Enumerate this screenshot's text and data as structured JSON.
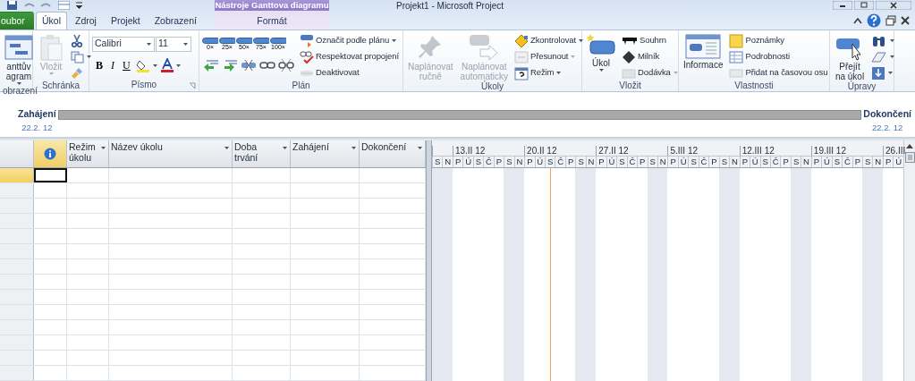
{
  "window": {
    "title": "Projekt1  -  Microsoft Project",
    "contextual_header": "Nástroje Ganttova diagramu"
  },
  "tabs": [
    {
      "label": "oubor",
      "kind": "file",
      "selected": false
    },
    {
      "label": "Úkol",
      "kind": "tab",
      "selected": true
    },
    {
      "label": "Zdroj",
      "kind": "tab",
      "selected": false
    },
    {
      "label": "Projekt",
      "kind": "tab",
      "selected": false
    },
    {
      "label": "Zobrazení",
      "kind": "tab",
      "selected": false
    },
    {
      "label": "Formát",
      "kind": "contextual",
      "selected": false
    }
  ],
  "ribbon": {
    "groups": [
      {
        "label": "obrazení",
        "items": [
          {
            "kind": "large",
            "lines": [
              "anttův",
              "agram"
            ],
            "dropdown": true,
            "disabled": false
          }
        ]
      },
      {
        "label": "Schránka",
        "items": [
          {
            "kind": "large",
            "lines": [
              "Vložit"
            ],
            "dropdown": true,
            "disabled": true
          },
          {
            "kind": "small",
            "dropdown": false,
            "disabled": false
          },
          {
            "kind": "small",
            "dropdown": true,
            "disabled": false
          },
          {
            "kind": "small",
            "dropdown": false,
            "disabled": false
          }
        ]
      },
      {
        "label": "Písmo",
        "launcher": true,
        "items": [
          {
            "kind": "toolbar",
            "lines": [
              {
                "controls": [
                  {
                    "kind": "combo",
                    "value": "Calibri"
                  },
                  {
                    "kind": "combo",
                    "value": "11"
                  }
                ]
              },
              {
                "controls": [
                  {
                    "kind": "text_button",
                    "label": "B"
                  },
                  {
                    "kind": "text_button",
                    "label": "I"
                  },
                  {
                    "kind": "text_button",
                    "label": "U"
                  },
                  {
                    "kind": "icon_button",
                    "dropdown": true
                  },
                  {
                    "kind": "icon_button",
                    "dropdown": true
                  }
                ]
              }
            ]
          }
        ]
      },
      {
        "label": "Plán",
        "items": [
          {
            "kind": "toolbar",
            "lines": [
              {
                "controls": [
                  {
                    "kind": "pct",
                    "label": "0×"
                  },
                  {
                    "kind": "pct",
                    "label": "25×"
                  },
                  {
                    "kind": "pct",
                    "label": "50×"
                  },
                  {
                    "kind": "pct",
                    "label": "75×"
                  },
                  {
                    "kind": "pct",
                    "label": "100×"
                  }
                ]
              },
              {
                "controls": [
                  {
                    "kind": "icon_button",
                    "dropdown": false
                  },
                  {
                    "kind": "icon_button",
                    "dropdown": false
                  },
                  {
                    "kind": "icon_button",
                    "dropdown": false
                  },
                  {
                    "kind": "icon_button",
                    "dropdown": false
                  },
                  {
                    "kind": "icon_button",
                    "dropdown": false
                  }
                ]
              }
            ]
          },
          {
            "kind": "small",
            "label": "Označit podle plánu",
            "dropdown": true,
            "disabled": false
          },
          {
            "kind": "small",
            "label": "Respektovat propojení",
            "dropdown": false,
            "disabled": false
          },
          {
            "kind": "small",
            "label": "Deaktivovat",
            "dropdown": false,
            "disabled": true
          }
        ]
      },
      {
        "label": "Úkoly",
        "items": [
          {
            "kind": "large",
            "lines": [
              "Naplánovat",
              "ručně"
            ],
            "dropdown": false,
            "disabled": true
          },
          {
            "kind": "large",
            "lines": [
              "Naplánovat",
              "automaticky"
            ],
            "dropdown": false,
            "disabled": true
          },
          {
            "kind": "small",
            "label": "Zkontrolovat",
            "dropdown": true,
            "disabled": false
          },
          {
            "kind": "small",
            "label": "Přesunout",
            "dropdown": true,
            "disabled": true
          },
          {
            "kind": "small",
            "label": "Režim",
            "dropdown": true,
            "disabled": false
          }
        ]
      },
      {
        "label": "Vložit",
        "items": [
          {
            "kind": "large",
            "lines": [
              "Úkol"
            ],
            "dropdown": true,
            "disabled": false
          },
          {
            "kind": "small",
            "label": "Souhrn",
            "dropdown": false,
            "disabled": false
          },
          {
            "kind": "small",
            "label": "Milník",
            "dropdown": false,
            "disabled": false
          },
          {
            "kind": "small",
            "label": "Dodávka",
            "dropdown": true,
            "disabled": true
          }
        ]
      },
      {
        "label": "Vlastnosti",
        "items": [
          {
            "kind": "large",
            "lines": [
              "Informace"
            ],
            "dropdown": false,
            "disabled": false
          },
          {
            "kind": "small",
            "label": "Poznámky",
            "dropdown": false,
            "disabled": false
          },
          {
            "kind": "small",
            "label": "Podrobnosti",
            "dropdown": false,
            "disabled": false
          },
          {
            "kind": "small",
            "label": "Přidat na časovou osu",
            "dropdown": false,
            "disabled": true
          }
        ]
      },
      {
        "label": "Úpravy",
        "items": [
          {
            "kind": "large",
            "lines": [
              "Přejít",
              "na úkol"
            ],
            "dropdown": false,
            "disabled": false
          },
          {
            "kind": "small",
            "dropdown": true,
            "disabled": false
          },
          {
            "kind": "small",
            "dropdown": true,
            "disabled": false
          },
          {
            "kind": "small",
            "dropdown": true,
            "disabled": false
          }
        ]
      }
    ]
  },
  "timeline": {
    "start_label": "Zahájení",
    "start_date": "22.2. 12",
    "finish_label": "Dokončení",
    "finish_date": "22.2. 12"
  },
  "table": {
    "columns": [
      {
        "kind": "info",
        "selected": true
      },
      {
        "kind": "text",
        "label": "Režim úkolu",
        "selected": false
      },
      {
        "kind": "text",
        "label": "Název úkolu",
        "selected": false
      },
      {
        "kind": "text",
        "label": "Doba trvání",
        "selected": false
      },
      {
        "kind": "text",
        "label": "Zahájení",
        "selected": false
      },
      {
        "kind": "text",
        "label": "Dokončení",
        "selected": false
      }
    ],
    "rows": [
      {
        "selected": true
      },
      {
        "selected": false
      },
      {
        "selected": false
      },
      {
        "selected": false
      },
      {
        "selected": false
      },
      {
        "selected": false
      },
      {
        "selected": false
      },
      {
        "selected": false
      },
      {
        "selected": false
      },
      {
        "selected": false
      },
      {
        "selected": false
      },
      {
        "selected": false
      },
      {
        "selected": false
      },
      {
        "selected": false
      }
    ]
  },
  "gantt": {
    "days": [
      {
        "label": "S",
        "weekend": true,
        "today": false
      },
      {
        "label": "N",
        "weekend": true,
        "today": false
      },
      {
        "label": "P",
        "week": "13.II 12",
        "weekend": false,
        "today": false
      },
      {
        "label": "Ú",
        "weekend": false,
        "today": false
      },
      {
        "label": "S",
        "weekend": false,
        "today": false
      },
      {
        "label": "Č",
        "weekend": false,
        "today": false
      },
      {
        "label": "P",
        "weekend": false,
        "today": false
      },
      {
        "label": "S",
        "weekend": true,
        "today": false
      },
      {
        "label": "N",
        "weekend": true,
        "today": false
      },
      {
        "label": "P",
        "week": "20.II 12",
        "weekend": false,
        "today": false
      },
      {
        "label": "Ú",
        "weekend": false,
        "today": false
      },
      {
        "label": "S",
        "weekend": false,
        "today": true
      },
      {
        "label": "Č",
        "weekend": false,
        "today": false
      },
      {
        "label": "P",
        "weekend": false,
        "today": false
      },
      {
        "label": "S",
        "weekend": true,
        "today": false
      },
      {
        "label": "N",
        "weekend": true,
        "today": false
      },
      {
        "label": "P",
        "week": "27.II 12",
        "weekend": false,
        "today": false
      },
      {
        "label": "Ú",
        "weekend": false,
        "today": false
      },
      {
        "label": "S",
        "weekend": false,
        "today": false
      },
      {
        "label": "Č",
        "weekend": false,
        "today": false
      },
      {
        "label": "P",
        "weekend": false,
        "today": false
      },
      {
        "label": "S",
        "weekend": true,
        "today": false
      },
      {
        "label": "N",
        "weekend": true,
        "today": false
      },
      {
        "label": "P",
        "week": "5.III 12",
        "weekend": false,
        "today": false
      },
      {
        "label": "Ú",
        "weekend": false,
        "today": false
      },
      {
        "label": "S",
        "weekend": false,
        "today": false
      },
      {
        "label": "Č",
        "weekend": false,
        "today": false
      },
      {
        "label": "P",
        "weekend": false,
        "today": false
      },
      {
        "label": "S",
        "weekend": true,
        "today": false
      },
      {
        "label": "N",
        "weekend": true,
        "today": false
      },
      {
        "label": "P",
        "week": "12.III 12",
        "weekend": false,
        "today": false
      },
      {
        "label": "Ú",
        "weekend": false,
        "today": false
      },
      {
        "label": "S",
        "weekend": false,
        "today": false
      },
      {
        "label": "Č",
        "weekend": false,
        "today": false
      },
      {
        "label": "P",
        "weekend": false,
        "today": false
      },
      {
        "label": "S",
        "weekend": true,
        "today": false
      },
      {
        "label": "N",
        "weekend": true,
        "today": false
      },
      {
        "label": "P",
        "week": "19.III 12",
        "weekend": false,
        "today": false
      },
      {
        "label": "Ú",
        "weekend": false,
        "today": false
      },
      {
        "label": "S",
        "weekend": false,
        "today": false
      },
      {
        "label": "Č",
        "weekend": false,
        "today": false
      },
      {
        "label": "P",
        "weekend": false,
        "today": false
      },
      {
        "label": "S",
        "weekend": true,
        "today": false
      },
      {
        "label": "N",
        "weekend": true,
        "today": false
      },
      {
        "label": "P",
        "week": "26.III",
        "weekend": false,
        "today": false
      },
      {
        "label": "Ú",
        "weekend": false,
        "today": false
      }
    ]
  }
}
